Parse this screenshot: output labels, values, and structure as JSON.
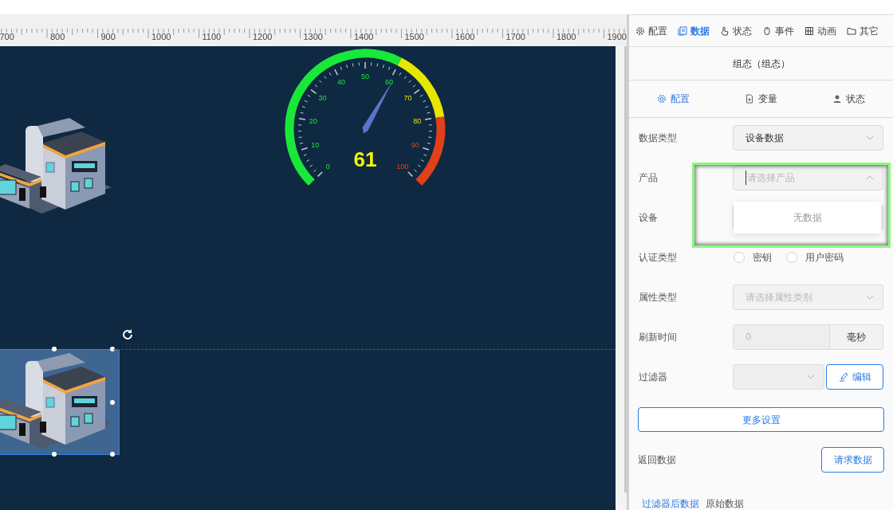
{
  "ruler": {
    "labels": [
      "700",
      "800",
      "900",
      "1000",
      "1100",
      "1200",
      "1300",
      "1400",
      "1500",
      "1600",
      "1700",
      "1800",
      "1900"
    ]
  },
  "canvas": {
    "buildings": [
      {
        "selected": false
      },
      {
        "selected": true
      }
    ],
    "gauge": {
      "value": "61",
      "level": 0.61,
      "scale": [
        {
          "color": "#19e83a",
          "labels": [
            "0",
            "10",
            "20",
            "30",
            "40",
            "50",
            "60"
          ]
        },
        {
          "color": "#e6e600",
          "labels": [
            "70",
            "80"
          ]
        },
        {
          "color": "#e0401a",
          "labels": [
            "90",
            "100"
          ]
        }
      ]
    }
  },
  "panel": {
    "tabs": [
      {
        "label": "配置",
        "selected": false
      },
      {
        "label": "数据",
        "selected": true
      },
      {
        "label": "状态",
        "selected": false
      },
      {
        "label": "事件",
        "selected": false
      },
      {
        "label": "动画",
        "selected": false
      },
      {
        "label": "其它",
        "selected": false
      }
    ],
    "title": "组态（组态）",
    "sub_tabs": [
      {
        "label": "配置",
        "selected": true
      },
      {
        "label": "变量",
        "selected": false
      },
      {
        "label": "状态",
        "selected": false
      }
    ],
    "rows": [
      {
        "kind": "select",
        "label": "数据类型",
        "value": "设备数据"
      },
      {
        "kind": "select",
        "label": "产品",
        "placeholder": "请选择产品",
        "expanded": true,
        "highlighted": true,
        "dropdown_text": "无数据"
      },
      {
        "kind": "select",
        "label": "设备"
      },
      {
        "kind": "radio",
        "label": "认证类型",
        "options": [
          {
            "label": "密钥",
            "selected": false
          },
          {
            "label": "用户密码",
            "selected": false
          }
        ]
      },
      {
        "kind": "select",
        "label": "属性类型",
        "placeholder": "请选择属性类别"
      },
      {
        "kind": "input",
        "label": "刷新时间",
        "placeholder": "0",
        "addon": "毫秒",
        "disabled": true
      },
      {
        "kind": "select_button",
        "label": "过滤器",
        "button": "编辑",
        "disabled": true
      }
    ],
    "more_button": "更多设置",
    "return_label": "返回数据",
    "request_button": "请求数据",
    "result_tabs": [
      {
        "label": "过滤器后数据",
        "selected": true
      },
      {
        "label": "原始数据",
        "selected": false
      }
    ]
  }
}
